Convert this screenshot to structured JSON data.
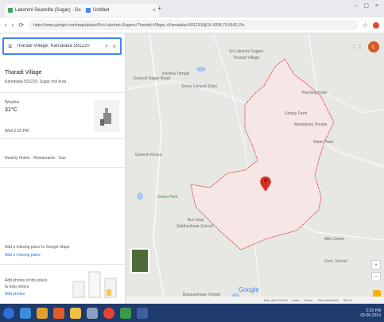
{
  "browser": {
    "tabs": [
      {
        "label": "Lakshmi Swamilla (Sugar) · Gc",
        "close": "×"
      },
      {
        "label": "Untitled",
        "close": "×"
      }
    ],
    "new_tab": "+",
    "window_controls": "– ▢ ×",
    "back": "‹",
    "forward": "›",
    "reload": "⟳",
    "url": "https://www.google.com/maps/place/Sri+Lakshmi+Sugars+Tharadi+Village,+Karnataka+591220/@16.4208,75.0542,15z",
    "bookmark": "☆"
  },
  "search": {
    "menu": "≡",
    "value": "Tharadi Village, Karnataka 591220",
    "search_icon": "⌕",
    "clear_icon": "×"
  },
  "panel": {
    "collapse": "◂",
    "place_title": "Tharadi Village",
    "place_subtitle": "Karnataka 591220, Sugar mill area",
    "weather_label": "Weather",
    "weather_value": "31°C",
    "weather_sub": "Wed 2:32 PM",
    "nearby": "Nearby Hotels · Restaurants · Gas",
    "add_place_line1": "Add a missing place to Google Maps",
    "add_place_link": "Add a missing place",
    "photos_line1": "Add photos of this place",
    "photos_line2": "to help others",
    "photos_link": "Add photos"
  },
  "map": {
    "apps_icon": "⋮⋮",
    "avatar_letter": "L",
    "labels": [
      {
        "text": "Sri Lakshmi Sugars",
        "cls": ""
      },
      {
        "text": "Tharadi Village",
        "cls": ""
      },
      {
        "text": "Krishna Temple",
        "cls": ""
      },
      {
        "text": "Shree Ganesh Dairy",
        "cls": ""
      },
      {
        "text": "Ganesh Nagar Road",
        "cls": ""
      },
      {
        "text": "Ramling Hotel",
        "cls": ""
      },
      {
        "text": "Sanjay Farm",
        "cls": ""
      },
      {
        "text": "Mahalaxmi Temple",
        "cls": ""
      },
      {
        "text": "Water Tank",
        "cls": ""
      },
      {
        "text": "Ganesh Kirana",
        "cls": ""
      },
      {
        "text": "Green Park",
        "cls": "green"
      },
      {
        "text": "Bus Stop",
        "cls": ""
      },
      {
        "text": "Siddheshwar School",
        "cls": ""
      },
      {
        "text": "Milk Center",
        "cls": ""
      },
      {
        "text": "Govt. School",
        "cls": ""
      },
      {
        "text": "Basaveshwar Temple",
        "cls": ""
      }
    ],
    "google": "Google",
    "zoom_in": "+",
    "zoom_out": "−",
    "footer": [
      "Map data ©2019",
      "India",
      "Terms",
      "Send feedback",
      "500 m"
    ]
  },
  "taskbar": {
    "time": "2:32 PM",
    "date": "05-06-2019"
  },
  "colors": {
    "area_fill": "#f7e6e6",
    "area_stroke": "#d93025",
    "pin": "#d93025",
    "taskbar": "#1f3b6e"
  }
}
